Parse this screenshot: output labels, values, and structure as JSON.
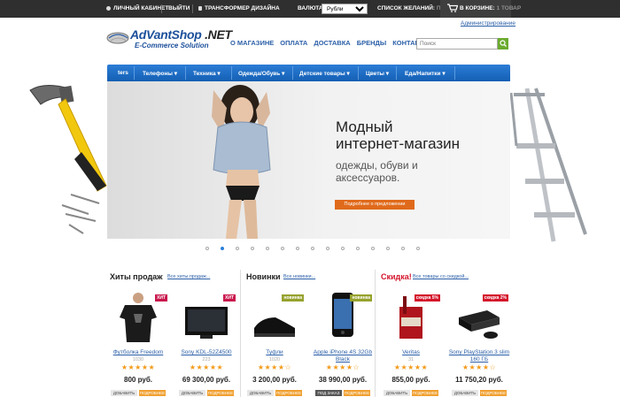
{
  "topbar": {
    "account": "Личный кабинет",
    "logout": "Выйти",
    "transform": "Трансформер дизайна",
    "currency_label": "Валюта:",
    "currency_value": "Рубли",
    "wishlist_label": "Список желаний:",
    "wishlist_value": "пуст",
    "cart_label": "В корзине:",
    "cart_value": "1 товар"
  },
  "header": {
    "logo_main": "AdVantShop",
    "logo_net": " .NET",
    "logo_sub": "E-Commerce Solution",
    "admin_link": "Администрирование",
    "nav": [
      "О магазине",
      "Оплата",
      "Доставка",
      "Бренды",
      "Контакты"
    ],
    "search_placeholder": "Поиск"
  },
  "catmenu": [
    "ters",
    "Телефоны ▾",
    "Техника ▾",
    "Одежда/Обувь ▾",
    "Детские товары ▾",
    "Цветы ▾",
    "Еда/Напитки ▾"
  ],
  "banner": {
    "title_line1": "Модный",
    "title_line2": "интернет-магазин",
    "subtitle_line1": "одежды, обуви и",
    "subtitle_line2": "аксессуаров.",
    "button": "Подробнее о предложении"
  },
  "slider": {
    "count": 15,
    "active_index": 1
  },
  "sections": [
    {
      "title": "Хиты продаж",
      "link": "Все хиты продаж..."
    },
    {
      "title": "Новинки",
      "link": "Все новинки..."
    },
    {
      "title": "Скидка!",
      "link": "Все товары со скидкой..."
    }
  ],
  "products": [
    {
      "name": "Футболка Freedom",
      "art": "1030",
      "price": "800 руб.",
      "badge": "ХИТ",
      "stars": "★★★★★",
      "btn1": "ДОБАВИТЬ",
      "btn2": "ПОДРОБНЕЕ"
    },
    {
      "name": "Sony KDL-52Z4500",
      "art": "223",
      "price": "69 300,00 руб.",
      "badge": "ХИТ",
      "stars": "★★★★★",
      "btn1": "ДОБАВИТЬ",
      "btn2": "ПОДРОБНЕЕ"
    },
    {
      "name": "Туфли",
      "art": "1020",
      "price": "3 200,00 руб.",
      "badge": "новинка",
      "stars": "★★★★☆",
      "btn1": "ДОБАВИТЬ",
      "btn2": "ПОДРОБНЕЕ"
    },
    {
      "name": "Apple iPhone 4S 32Gb Black",
      "art": "",
      "price": "38 990,00 руб.",
      "badge": "новинка",
      "stars": "★★★★☆",
      "btn1": "ПОД ЗАКАЗ",
      "btn2": "ПОДРОБНЕЕ"
    },
    {
      "name": "Veritas",
      "art": "31",
      "price": "855,00 руб.",
      "badge": "скидка 5%",
      "stars": "★★★★★",
      "btn1": "ДОБАВИТЬ",
      "btn2": "ПОДРОБНЕЕ"
    },
    {
      "name": "Sony PlayStation 3 slim 160 ГБ",
      "art": "",
      "price": "11 750,20 руб.",
      "badge": "скидка 2%",
      "stars": "★★★★☆",
      "btn1": "ДОБАВИТЬ",
      "btn2": "ПОДРОБНЕЕ"
    }
  ],
  "colors": {
    "accent": "#135fb4",
    "link": "#2b5fa8",
    "sale": "#d4142a",
    "button": "#e06a1b"
  }
}
